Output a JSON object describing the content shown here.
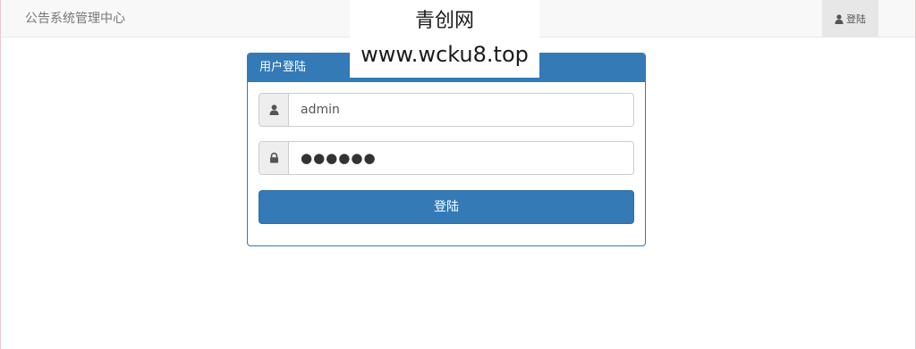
{
  "navbar": {
    "brand": "公告系统管理中心",
    "login_link": {
      "icon": "user-icon",
      "label": "登陆"
    }
  },
  "watermark": {
    "line1": "青创网",
    "line2": "www.wcku8.top"
  },
  "login_panel": {
    "title": "用户登陆",
    "username": {
      "icon": "user-icon",
      "value": "admin"
    },
    "password": {
      "icon": "lock-icon",
      "masked_value": "●●●●●●"
    },
    "submit_label": "登陆"
  },
  "colors": {
    "primary": "#337ab7",
    "navbar_bg": "#f8f8f8",
    "addon_bg": "#eeeeee"
  }
}
